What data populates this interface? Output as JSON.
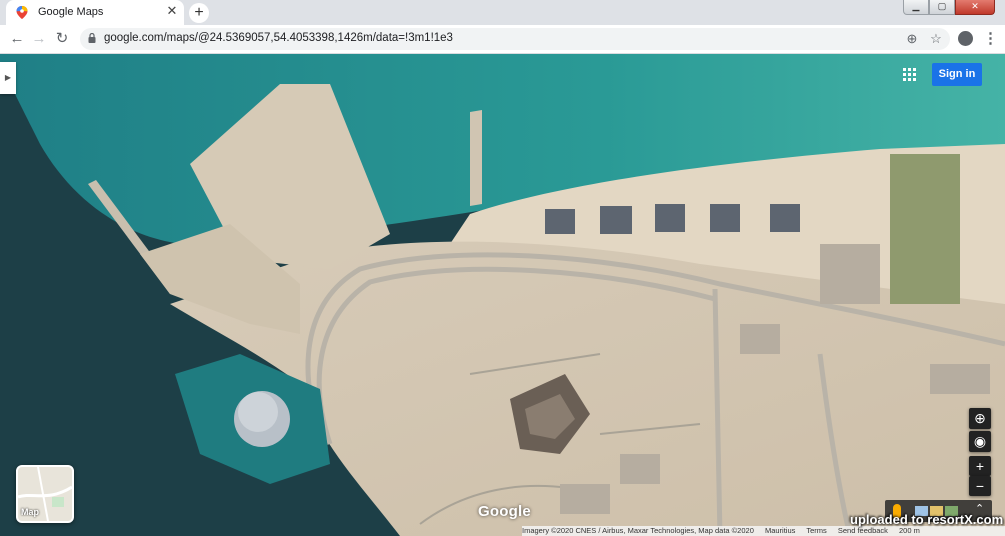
{
  "browser": {
    "tab": {
      "title": "Google Maps"
    },
    "address": {
      "url": "google.com/maps/@24.5369057,54.4053398,1426m/data=!3m1!1e3"
    }
  },
  "maps": {
    "signin_label": "Sign in",
    "layer_label": "Map",
    "logo_text": "Google",
    "attribution": {
      "imagery": "Imagery ©2020 CNES / Airbus, Maxar Technologies, Map data ©2020",
      "country": "Mauritius",
      "terms": "Terms",
      "feedback": "Send feedback",
      "scale": "200 m"
    },
    "controls": {
      "zoom_in": "+",
      "zoom_out": "−",
      "expand": "⌃"
    }
  },
  "watermark": "uploaded to resortX.com",
  "colors": {
    "sea_deep": "#1d3f47",
    "sea_shallow": "#1d8c8c",
    "sand": "#d9cfc0",
    "signin_blue": "#1a73e8"
  }
}
